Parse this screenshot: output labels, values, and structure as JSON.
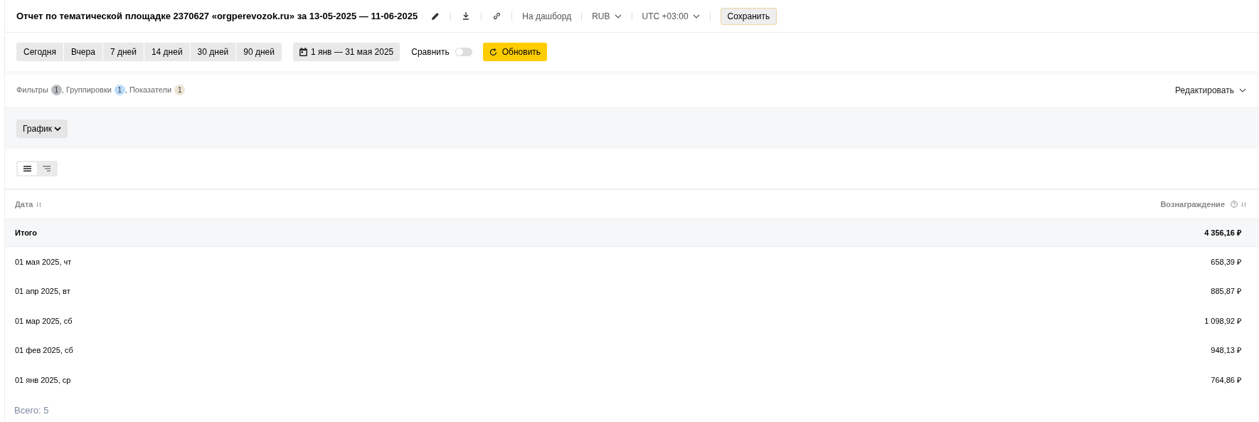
{
  "header": {
    "title": "Отчет по тематической площадке 2370627 «orgperevozok.ru» за 13-05-2025 — 11-06-2025",
    "actions": [
      {
        "kind": "edit"
      },
      {
        "kind": "download"
      },
      {
        "kind": "link"
      },
      {
        "kind": "text",
        "label": "На дашборд"
      },
      {
        "kind": "dropdown",
        "label": "RUB"
      },
      {
        "kind": "dropdown",
        "label": "UTC +03:00"
      },
      {
        "kind": "button",
        "label": "Сохранить"
      }
    ]
  },
  "toolbar": {
    "periods": [
      {
        "label": "Сегодня",
        "selected": false
      },
      {
        "label": "Вчера",
        "selected": false
      },
      {
        "label": "7 дней",
        "selected": false
      },
      {
        "label": "14 дней",
        "selected": false
      },
      {
        "label": "30 дней",
        "selected": false
      },
      {
        "label": "90 дней",
        "selected": false
      }
    ],
    "date_range": "1 янв — 31 мая 2025",
    "compare": {
      "label": "Сравнить",
      "on": false
    },
    "refresh": "Обновить"
  },
  "settings": {
    "items": [
      {
        "label": "Фильтры",
        "count": "1",
        "color": "#b9bcc1"
      },
      {
        "label": "Группировки",
        "count": "1",
        "color": "#bcdcfb"
      },
      {
        "label": "Показатели",
        "count": "1",
        "color": "#efe5d6"
      }
    ],
    "separator": ",",
    "edit": "Редактировать"
  },
  "chart_panel": {
    "dropdown": "График"
  },
  "view_toggle": [
    {
      "kind": "list",
      "selected": true
    },
    {
      "kind": "tree",
      "selected": false
    }
  ],
  "table": {
    "columns": [
      "Дата",
      "Вознаграждение"
    ],
    "total": [
      "Итого",
      "4 356,16 ₽"
    ],
    "rows": [
      [
        "01 мая 2025, чт",
        "658,39 ₽"
      ],
      [
        "01 апр 2025, вт",
        "885,87 ₽"
      ],
      [
        "01 мар 2025, сб",
        "1 098,92 ₽"
      ],
      [
        "01 фев 2025, сб",
        "948,13 ₽"
      ],
      [
        "01 янв 2025, ср",
        "764,86 ₽"
      ]
    ],
    "footer": "Всего: 5"
  }
}
